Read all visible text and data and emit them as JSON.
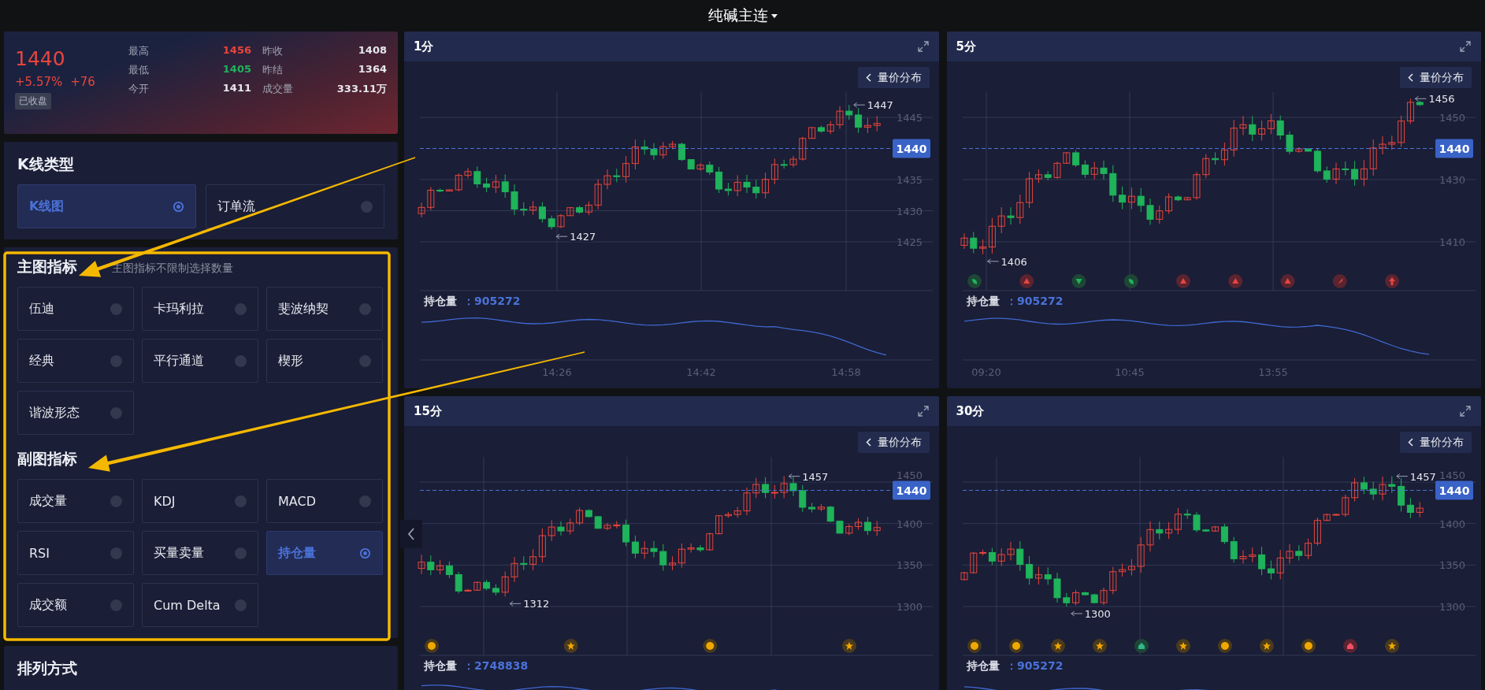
{
  "title": "纯碱主连",
  "quote": {
    "price": "1440",
    "change_pct": "+5.57%",
    "change": "+76",
    "status": "已收盘",
    "stats": [
      {
        "label": "最高",
        "value": "1456",
        "color": "#e8453c"
      },
      {
        "label": "昨收",
        "value": "1408",
        "color": "#e6e8ee"
      },
      {
        "label": "最低",
        "value": "1405",
        "color": "#1fb35b"
      },
      {
        "label": "昨结",
        "value": "1364",
        "color": "#e6e8ee"
      },
      {
        "label": "今开",
        "value": "1411",
        "color": "#e6e8ee"
      },
      {
        "label": "成交量",
        "value": "333.11万",
        "color": "#e6e8ee"
      }
    ]
  },
  "kline_type": {
    "title": "K线类型",
    "options": [
      {
        "label": "K线图",
        "selected": true
      },
      {
        "label": "订单流",
        "selected": false
      }
    ]
  },
  "main_indicators": {
    "title": "主图指标",
    "note": "主图指标不限制选择数量",
    "options": [
      {
        "label": "伍迪",
        "selected": false
      },
      {
        "label": "卡玛利拉",
        "selected": false
      },
      {
        "label": "斐波纳契",
        "selected": false
      },
      {
        "label": "经典",
        "selected": false
      },
      {
        "label": "平行通道",
        "selected": false
      },
      {
        "label": "楔形",
        "selected": false
      },
      {
        "label": "谐波形态",
        "selected": false
      }
    ]
  },
  "sub_indicators": {
    "title": "副图指标",
    "options": [
      {
        "label": "成交量",
        "selected": false
      },
      {
        "label": "KDJ",
        "selected": false
      },
      {
        "label": "MACD",
        "selected": false
      },
      {
        "label": "RSI",
        "selected": false
      },
      {
        "label": "买量卖量",
        "selected": false
      },
      {
        "label": "持仓量",
        "selected": true
      },
      {
        "label": "成交额",
        "selected": false
      },
      {
        "label": "Cum Delta",
        "selected": false
      }
    ]
  },
  "arrange": {
    "title": "排列方式"
  },
  "charts": [
    {
      "title": "1分",
      "button": "量价分布",
      "yticks": [
        "1445",
        "1435",
        "1430",
        "1425"
      ],
      "last_price": "1440",
      "high_label": "1447",
      "low_label": "1427",
      "sub_label": "持仓量",
      "sub_value": "：905272",
      "time_labels": [
        "14:26",
        "14:42",
        "14:58"
      ]
    },
    {
      "title": "5分",
      "button": "量价分布",
      "yticks": [
        "1450",
        "1430",
        "1410"
      ],
      "last_price": "1440",
      "high_label": "1456",
      "low_label": "1406",
      "sub_label": "持仓量",
      "sub_value": "：905272",
      "time_labels": [
        "09:20",
        "10:45",
        "13:55"
      ],
      "markers": [
        {
          "kind": "leaf"
        },
        {
          "kind": "up"
        },
        {
          "kind": "down"
        },
        {
          "kind": "leaf"
        },
        {
          "kind": "up"
        },
        {
          "kind": "up"
        },
        {
          "kind": "up"
        },
        {
          "kind": "rocket"
        },
        {
          "kind": "arrow"
        }
      ]
    },
    {
      "title": "15分",
      "button": "量价分布",
      "yticks": [
        "1450",
        "1400",
        "1350",
        "1300"
      ],
      "last_price": "1440",
      "high_label": "1457",
      "low_label": "1312",
      "sub_label": "持仓量",
      "sub_value": "：2748838",
      "markers": [
        {
          "kind": "coin"
        },
        {
          "kind": "star"
        },
        {
          "kind": "coin"
        },
        {
          "kind": "star"
        }
      ]
    },
    {
      "title": "30分",
      "button": "量价分布",
      "yticks": [
        "1450",
        "1400",
        "1350",
        "1300"
      ],
      "last_price": "1440",
      "high_label": "1457",
      "low_label": "1300",
      "sub_label": "持仓量",
      "sub_value": "：905272",
      "markers": [
        {
          "kind": "coin"
        },
        {
          "kind": "coin"
        },
        {
          "kind": "star"
        },
        {
          "kind": "star"
        },
        {
          "kind": "house-green"
        },
        {
          "kind": "star"
        },
        {
          "kind": "coin"
        },
        {
          "kind": "star"
        },
        {
          "kind": "coin"
        },
        {
          "kind": "house-red"
        },
        {
          "kind": "star"
        }
      ]
    }
  ],
  "annotations": [
    {
      "kind": "frame"
    },
    {
      "kind": "arrow"
    },
    {
      "kind": "arrow"
    }
  ]
}
